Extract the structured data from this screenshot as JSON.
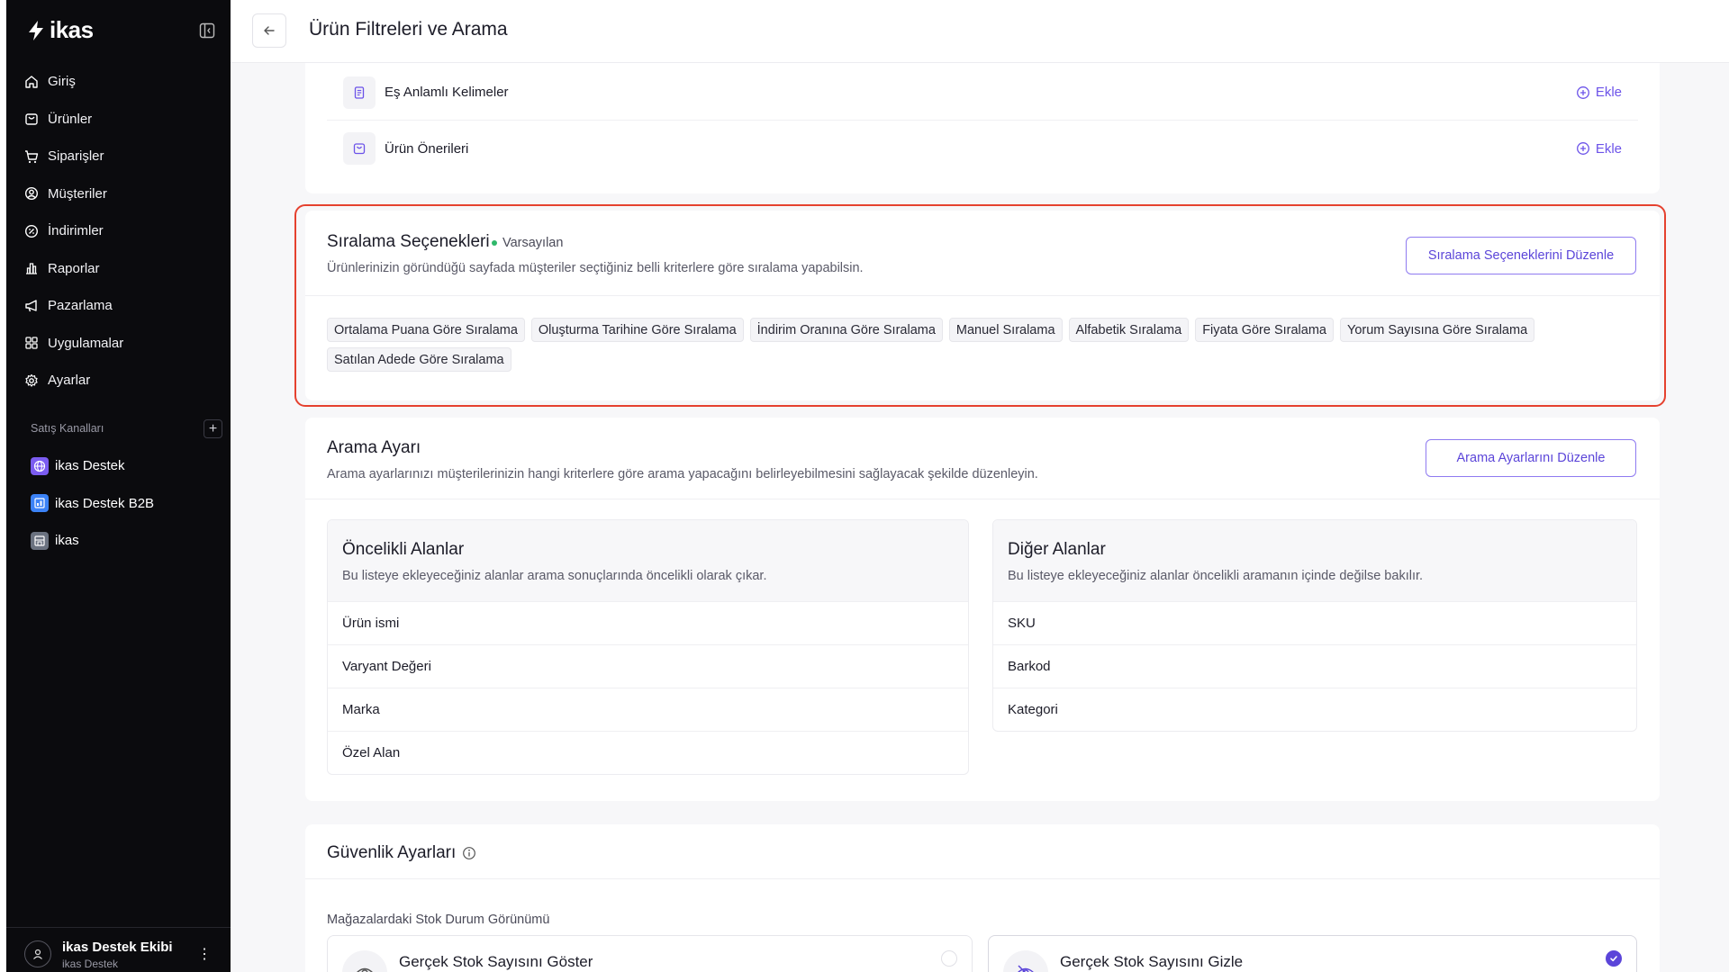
{
  "app": {
    "logo_text": "ikas"
  },
  "header": {
    "title": "Ürün Filtreleri ve Arama"
  },
  "sidebar": {
    "items": [
      {
        "label": "Giriş",
        "icon": "home-icon"
      },
      {
        "label": "Ürünler",
        "icon": "bag-icon"
      },
      {
        "label": "Siparişler",
        "icon": "cart-icon"
      },
      {
        "label": "Müşteriler",
        "icon": "user-circle-icon"
      },
      {
        "label": "İndirimler",
        "icon": "discount-icon"
      },
      {
        "label": "Raporlar",
        "icon": "chart-icon"
      },
      {
        "label": "Pazarlama",
        "icon": "megaphone-icon"
      },
      {
        "label": "Uygulamalar",
        "icon": "grid-icon"
      },
      {
        "label": "Ayarlar",
        "icon": "gear-icon"
      }
    ],
    "channels_title": "Satış Kanalları",
    "channels": [
      {
        "label": "ikas Destek",
        "icon": "globe-icon",
        "color": "#7b5cf0"
      },
      {
        "label": "ikas Destek B2B",
        "icon": "b2b-icon",
        "color": "#3b82f6"
      },
      {
        "label": "ikas",
        "icon": "store-icon",
        "color": "#6b7280"
      }
    ],
    "user": {
      "name": "ikas Destek Ekibi",
      "sub": "ikas Destek"
    }
  },
  "top_card": {
    "rows": [
      {
        "label": "Eş Anlamlı Kelimeler",
        "action": "Ekle",
        "icon": "document-icon"
      },
      {
        "label": "Ürün Önerileri",
        "action": "Ekle",
        "icon": "bag-icon"
      }
    ]
  },
  "sorting": {
    "title": "Sıralama Seçenekleri",
    "badge": "Varsayılan",
    "description": "Ürünlerinizin göründüğü sayfada müşteriler seçtiğiniz belli kriterlere göre sıralama yapabilsin.",
    "edit_button": "Sıralama Seçeneklerini Düzenle",
    "options": [
      "Ortalama Puana Göre Sıralama",
      "Oluşturma Tarihine Göre Sıralama",
      "İndirim Oranına Göre Sıralama",
      "Manuel Sıralama",
      "Alfabetik Sıralama",
      "Fiyata Göre Sıralama",
      "Yorum Sayısına Göre Sıralama",
      "Satılan Adede Göre Sıralama"
    ]
  },
  "search": {
    "title": "Arama Ayarı",
    "description": "Arama ayarlarınızı müşterilerinizin hangi kriterlere göre arama yapacağını belirleyebilmesini sağlayacak şekilde düzenleyin.",
    "edit_button": "Arama Ayarlarını Düzenle",
    "priority": {
      "title": "Öncelikli Alanlar",
      "description": "Bu listeye ekleyeceğiniz alanlar arama sonuçlarında öncelikli olarak çıkar.",
      "items": [
        "Ürün ismi",
        "Varyant Değeri",
        "Marka",
        "Özel Alan"
      ]
    },
    "other": {
      "title": "Diğer Alanlar",
      "description": "Bu listeye ekleyeceğiniz alanlar öncelikli aramanın içinde değilse bakılır.",
      "items": [
        "SKU",
        "Barkod",
        "Kategori"
      ]
    }
  },
  "security": {
    "title": "Güvenlik Ayarları",
    "stock_label": "Mağazalardaki Stok Durum Görünümü",
    "options": [
      {
        "title": "Gerçek Stok Sayısını Göster",
        "selected": false
      },
      {
        "title": "Gerçek Stok Sayısını Gizle",
        "selected": true
      }
    ]
  },
  "colors": {
    "accent": "#5b45d9",
    "highlight": "#e5412f",
    "badge_dot": "#2fb86a"
  }
}
